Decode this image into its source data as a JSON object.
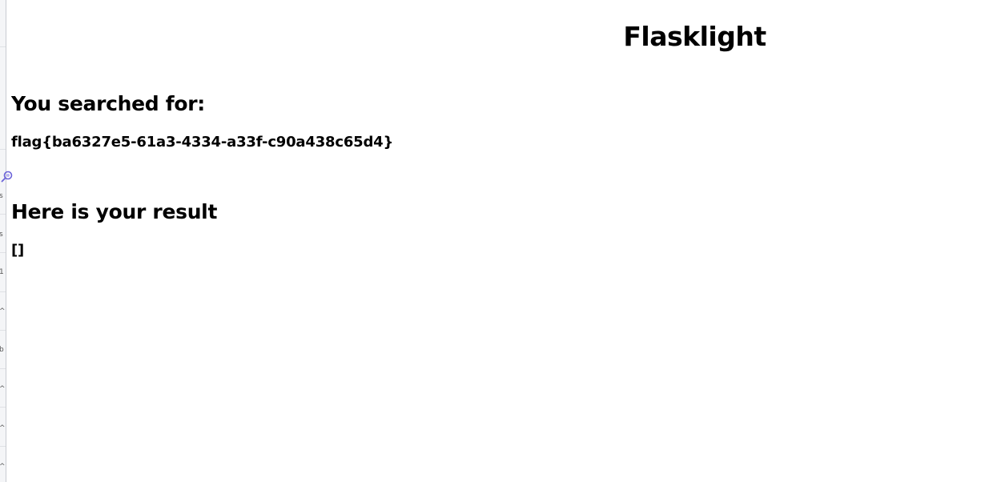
{
  "page": {
    "title": "Flasklight"
  },
  "search": {
    "heading": "You searched for:",
    "query": "flag{ba6327e5-61a3-4334-a33f-c90a438c65d4}"
  },
  "result": {
    "heading": "Here is your result",
    "value": "[]"
  },
  "left_strip": {
    "glyphs": [
      "s",
      "s",
      "1",
      "^",
      "b",
      "^",
      "^",
      "^"
    ]
  },
  "colors": {
    "background": "#ffffff",
    "text": "#000000",
    "cursor_accent": "#6b63d9"
  }
}
